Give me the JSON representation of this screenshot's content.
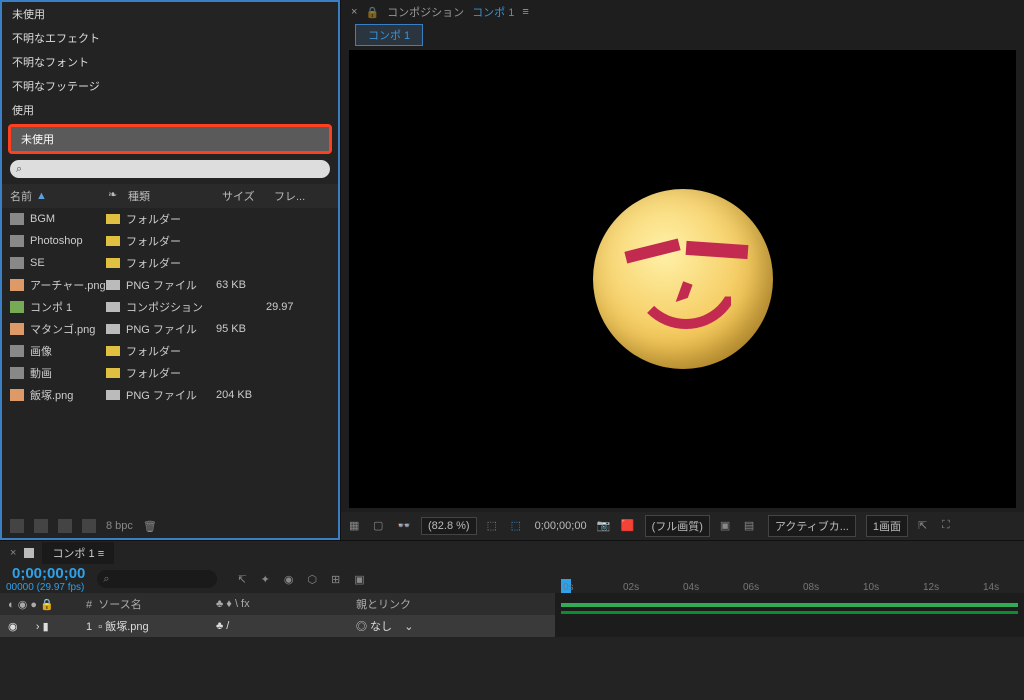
{
  "filters": {
    "header": "未使用",
    "items": [
      "不明なエフェクト",
      "不明なフォント",
      "不明なフッテージ",
      "使用"
    ],
    "highlighted": "未使用"
  },
  "search_icon": "⌕",
  "project": {
    "columns": {
      "name": "名前",
      "tag": "❧",
      "type": "種類",
      "size": "サイズ",
      "fps": "フレ..."
    },
    "rows": [
      {
        "name": "BGM",
        "type": "フォルダー",
        "size": "",
        "fps": "",
        "swatch": "sw-y",
        "ico": "folder-ico"
      },
      {
        "name": "Photoshop",
        "type": "フォルダー",
        "size": "",
        "fps": "",
        "swatch": "sw-y",
        "ico": "folder-ico"
      },
      {
        "name": "SE",
        "type": "フォルダー",
        "size": "",
        "fps": "",
        "swatch": "sw-y",
        "ico": "folder-ico"
      },
      {
        "name": "アーチャー.png",
        "type": "PNG ファイル",
        "size": "63 KB",
        "fps": "",
        "swatch": "sw-g",
        "ico": "img-ico"
      },
      {
        "name": "コンポ 1",
        "type": "コンポジション",
        "size": "",
        "fps": "29.97",
        "swatch": "sw-g",
        "ico": "comp-ico"
      },
      {
        "name": "マタンゴ.png",
        "type": "PNG ファイル",
        "size": "95 KB",
        "fps": "",
        "swatch": "sw-g",
        "ico": "img-ico"
      },
      {
        "name": "画像",
        "type": "フォルダー",
        "size": "",
        "fps": "",
        "swatch": "sw-y",
        "ico": "folder-ico"
      },
      {
        "name": "動画",
        "type": "フォルダー",
        "size": "",
        "fps": "",
        "swatch": "sw-y",
        "ico": "folder-ico"
      },
      {
        "name": "飯塚.png",
        "type": "PNG ファイル",
        "size": "204 KB",
        "fps": "",
        "swatch": "sw-g",
        "ico": "img-ico"
      }
    ],
    "footer_bpc": "8 bpc"
  },
  "comp": {
    "prefix": "コンポジション",
    "name": "コンポ 1",
    "tab": "コンポ 1",
    "menu_glyph": "≡",
    "lock_glyph": "🔒",
    "close_glyph": "×"
  },
  "viewer_footer": {
    "zoom": "(82.8 %)",
    "time": "0;00;00;00",
    "quality": "(フル画質)",
    "view": "アクティブカ...",
    "screens": "1画面"
  },
  "timeline": {
    "tab": "コンポ 1",
    "timecode": "0;00;00;00",
    "frame_label": "00000 (29.97 fps)",
    "search_icon": "⌕",
    "columns": {
      "a_prefix": "#",
      "a": "ソース名",
      "b": "♣ ♦ \\ fx",
      "c": "親とリンク"
    },
    "toggles": "◐ ◉ ● 🔒",
    "layer": {
      "idx": "1",
      "name": "飯塚.png",
      "mode": "♣   /",
      "parent": "◎ なし",
      "parent_chev": "⌄"
    },
    "ticks": [
      "0s",
      "02s",
      "04s",
      "06s",
      "08s",
      "10s",
      "12s",
      "14s"
    ]
  }
}
